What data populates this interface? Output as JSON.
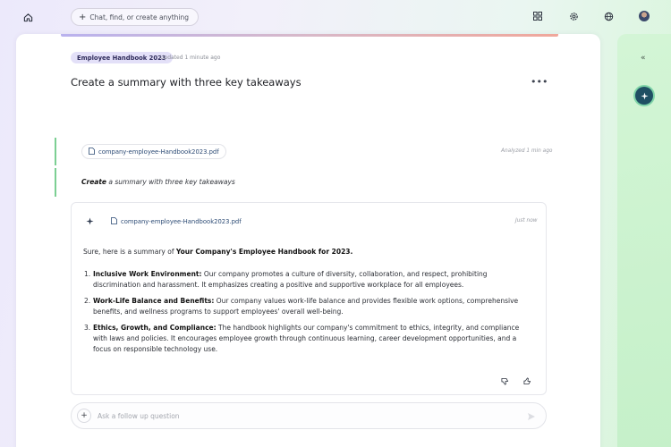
{
  "topbar": {
    "search_placeholder": "Chat, find, or create anything",
    "icons": [
      "home-icon",
      "grid-icon",
      "gear-icon",
      "globe-icon",
      "avatar"
    ]
  },
  "doc": {
    "tag": "Employee Handbook 2023",
    "updated": "Updated 1 minute ago",
    "title": "Create a summary with three key takeaways"
  },
  "user_message": {
    "file": "company-employee-Handbook2023.pdf",
    "analyzed": "Analyzed 1 min ago",
    "prompt_bold": "Create",
    "prompt_rest": " a summary with three key takeaways"
  },
  "response": {
    "file": "company-employee-Handbook2023.pdf",
    "time": "Just now",
    "intro_prefix": "Sure, here is a summary of ",
    "intro_bold": "Your Company's Employee Handbook for 2023.",
    "items": [
      {
        "num": "1.",
        "title": "Inclusive Work Environment:",
        "text": " Our company promotes a culture of diversity, collaboration, and respect, prohibiting discrimination and harassment. It emphasizes creating a positive and supportive workplace for all employees."
      },
      {
        "num": "2.",
        "title": "Work-Life Balance and Benefits:",
        "text": " Our company values work-life balance and provides flexible work options, comprehensive benefits, and wellness programs to support employees' overall well-being."
      },
      {
        "num": "3.",
        "title": "Ethics, Growth, and Compliance:",
        "text": " The handbook highlights our company's commitment to ethics, integrity, and compliance with laws and policies. It encourages employee growth through continuous learning, career development opportunities, and a focus on responsible technology use."
      }
    ]
  },
  "followup": {
    "placeholder": "Ask a follow up question"
  },
  "side_panel": {
    "collapse_label": "«"
  },
  "colors": {
    "accent_green": "#7ccf93",
    "tag_bg": "#e3e0f8",
    "side_button": "#1f4f63"
  }
}
